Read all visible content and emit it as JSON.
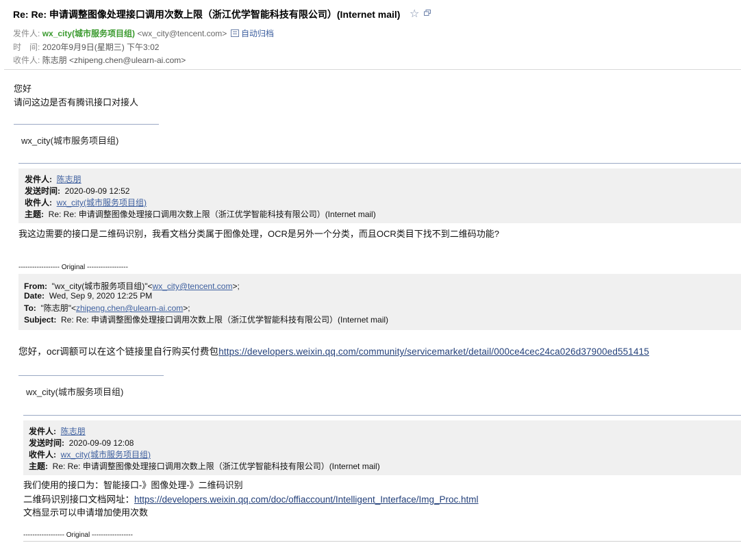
{
  "header": {
    "subject": "Re: Re: 申请调整图像处理接口调用次数上限（浙江优学智能科技有限公司）(Internet mail)",
    "from_label": "发件人:",
    "from_name": "wx_city(城市服务项目组)",
    "from_addr": "<wx_city@tencent.com>",
    "archive_label": "自动归档",
    "time_label": "时　间:",
    "time_value": "2020年9月9日(星期三) 下午3:02",
    "to_label": "收件人:",
    "to_value": "陈志朋 <zhipeng.chen@ulearn-ai.com>"
  },
  "body": {
    "greeting": "您好",
    "question": "请问这边是否有腾讯接口对接人",
    "signature": "wx_city(城市服务项目组)"
  },
  "quote1": {
    "from_label": "发件人:",
    "from_value": "陈志朋",
    "sent_label": "发送时间:",
    "sent_value": "2020-09-09 12:52",
    "to_label": "收件人:",
    "to_value": "wx_city(城市服务项目组)",
    "subject_label": "主题:",
    "subject_value": "Re: Re: 申请调整图像处理接口调用次数上限（浙江优学智能科技有限公司）(Internet mail)",
    "body": "我这边需要的接口是二维码识别，我看文档分类属于图像处理，OCR是另外一个分类，而且OCR类目下找不到二维码功能?"
  },
  "original1": {
    "divider": "------------------ Original ------------------",
    "from_label": "From:",
    "from_name": "\"wx_city(城市服务项目组)\"<",
    "from_email": "wx_city@tencent.com",
    "from_tail": ">;",
    "date_label": "Date:",
    "date_value": "Wed, Sep 9, 2020 12:25 PM",
    "to_label": "To:",
    "to_name": "\"陈志朋\"<",
    "to_email": "zhipeng.chen@ulearn-ai.com",
    "to_tail": ">;",
    "subject_label": "Subject:",
    "subject_value": "Re: Re: 申请调整图像处理接口调用次数上限（浙江优学智能科技有限公司）(Internet mail)",
    "body_prefix": "您好，ocr调额可以在这个链接里自行购买付费包",
    "body_url": "https://developers.weixin.qq.com/community/servicemarket/detail/000ce4cec24ca026d37900ed551415",
    "signature": "wx_city(城市服务项目组)"
  },
  "quote2": {
    "from_label": "发件人:",
    "from_value": "陈志朋",
    "sent_label": "发送时间:",
    "sent_value": "2020-09-09 12:08",
    "to_label": "收件人:",
    "to_value": "wx_city(城市服务项目组)",
    "subject_label": "主题:",
    "subject_value": "Re: Re: 申请调整图像处理接口调用次数上限（浙江优学智能科技有限公司）(Internet mail)",
    "line1": "我们使用的接口为：智能接口-》图像处理-》二维码识别",
    "line2_prefix": "二维码识别接口文档网址：",
    "line2_url": "https://developers.weixin.qq.com/doc/offiaccount/Intelligent_Interface/Img_Proc.html",
    "line3": " 文档显示可以申请增加使用次数"
  },
  "original2": {
    "divider": "------------------ Original ------------------"
  },
  "icons": {
    "star": "star-icon",
    "popout": "new-window-icon",
    "archive": "archive-icon"
  }
}
